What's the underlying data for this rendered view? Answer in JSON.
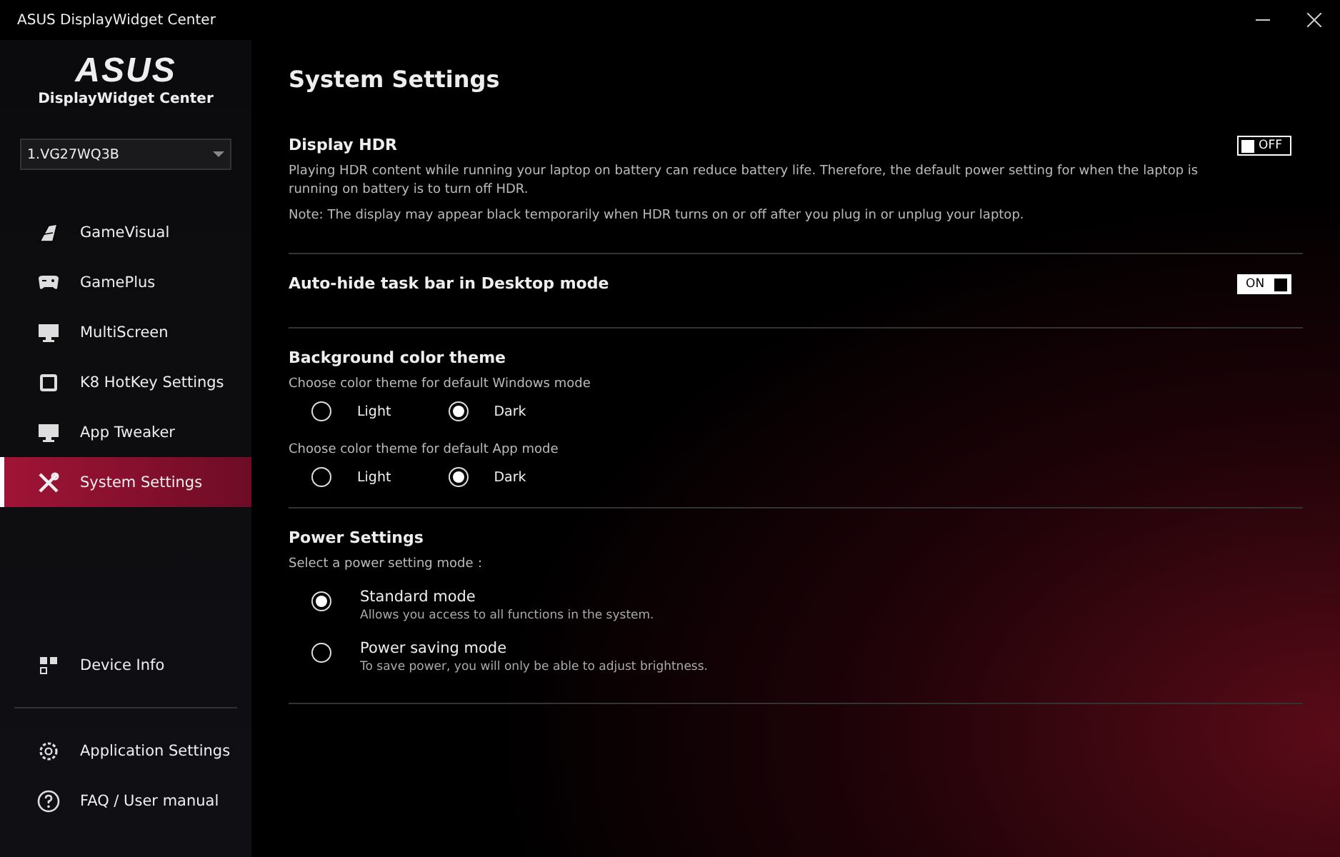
{
  "window": {
    "title": "ASUS DisplayWidget Center"
  },
  "sidebar": {
    "logo": "ASUS",
    "app_name": "DisplayWidget Center",
    "monitor_select": {
      "value": "1.VG27WQ3B"
    },
    "items": [
      {
        "label": "GameVisual",
        "kind": "gamevisual",
        "selected": false
      },
      {
        "label": "GamePlus",
        "kind": "gamepad",
        "selected": false
      },
      {
        "label": "MultiScreen",
        "kind": "monitor",
        "selected": false
      },
      {
        "label": "K8 HotKey Settings",
        "kind": "square",
        "selected": false
      },
      {
        "label": "App Tweaker",
        "kind": "monitor",
        "selected": false
      },
      {
        "label": "System Settings",
        "kind": "tools",
        "selected": true
      }
    ],
    "device_info": {
      "label": "Device Info"
    },
    "bottom_items": [
      {
        "label": "Application Settings",
        "kind": "gear"
      },
      {
        "label": "FAQ / User manual",
        "kind": "help"
      }
    ]
  },
  "page": {
    "title": "System Settings",
    "display_hdr": {
      "title": "Display HDR",
      "description": "Playing HDR content while running your laptop on battery can reduce battery life. Therefore, the default power setting for when the laptop is running on battery is to turn off HDR.",
      "note": "Note: The display may appear black temporarily when HDR turns on or off after you plug in or unplug your laptop.",
      "toggle": {
        "on": false,
        "label": "OFF"
      }
    },
    "auto_hide": {
      "title": "Auto-hide task bar in Desktop mode",
      "toggle": {
        "on": true,
        "label": "ON"
      }
    },
    "background_theme": {
      "title": "Background color theme",
      "groups": [
        {
          "caption": "Choose color theme for default Windows mode",
          "options": [
            {
              "label": "Light",
              "selected": false
            },
            {
              "label": "Dark",
              "selected": true
            }
          ]
        },
        {
          "caption": "Choose color theme for default App mode",
          "options": [
            {
              "label": "Light",
              "selected": false
            },
            {
              "label": "Dark",
              "selected": true
            }
          ]
        }
      ]
    },
    "power": {
      "title": "Power Settings",
      "caption": "Select a power setting mode：",
      "options": [
        {
          "label": "Standard mode",
          "description": "Allows you access to all functions in the system.",
          "selected": true
        },
        {
          "label": "Power saving mode",
          "description": "To save power, you will only be able to adjust brightness.",
          "selected": false
        }
      ]
    }
  }
}
